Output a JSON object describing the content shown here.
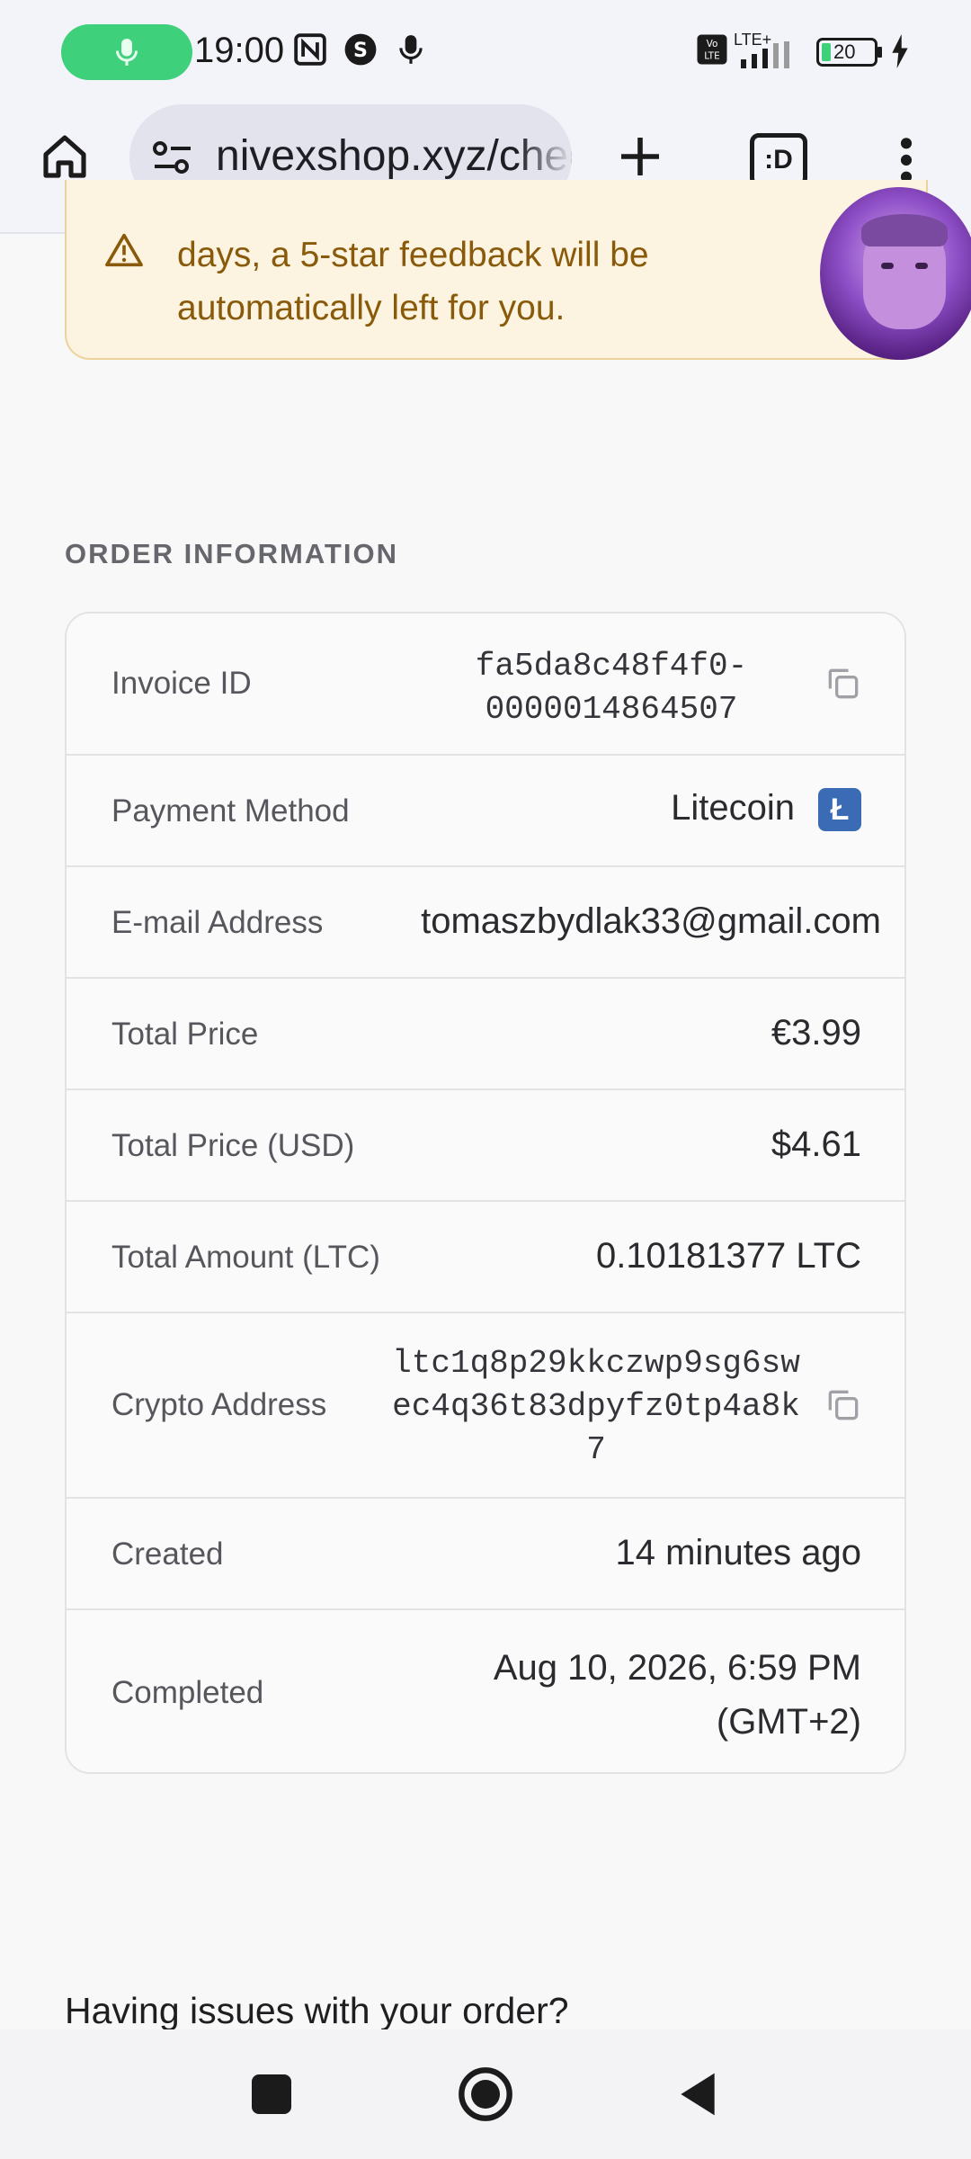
{
  "status_bar": {
    "time": "19:00",
    "network": "LTE+",
    "battery": "20",
    "volte": "Vo LTE"
  },
  "browser": {
    "url": "nivexshop.xyz/checkout",
    "tab_count_label": ":D"
  },
  "alert": {
    "text": "days, a 5-star feedback will be automatically left for you.",
    "icon": "warning-triangle-icon"
  },
  "order_info": {
    "section_title": "ORDER INFORMATION",
    "rows": {
      "invoice": {
        "label": "Invoice ID",
        "value": "fa5da8c48f4f0-0000014864507"
      },
      "payment": {
        "label": "Payment Method",
        "value": "Litecoin",
        "badge": "Ł"
      },
      "email": {
        "label": "E-mail Address",
        "value": "tomaszbydlak33@gmail.com"
      },
      "total_price": {
        "label": "Total Price",
        "value": "€3.99"
      },
      "total_usd": {
        "label": "Total Price (USD)",
        "value": "$4.61"
      },
      "total_ltc": {
        "label": "Total Amount (LTC)",
        "value": "0.10181377 LTC"
      },
      "crypto_address": {
        "label": "Crypto Address",
        "value": "ltc1q8p29kkczwp9sg6swec4q36t83dpyfz0tp4a8k7"
      },
      "created": {
        "label": "Created",
        "value": "14 minutes ago"
      },
      "completed": {
        "label": "Completed",
        "value": "Aug 10, 2026, 6:59 PM (GMT+2)"
      }
    }
  },
  "help": {
    "text": "Having issues with your order?"
  },
  "colors": {
    "accent_green": "#3ed07a",
    "alert_bg": "#fcf4e1",
    "alert_text": "#8a5a0b",
    "litecoin_blue": "#3c6bb5"
  }
}
